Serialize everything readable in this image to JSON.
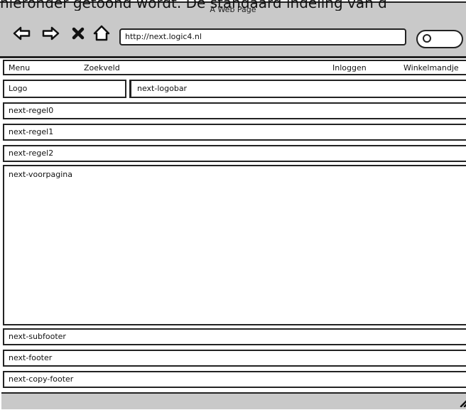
{
  "caption": "hieronder getoond wordt. De standaard indeling van d",
  "window": {
    "title": "A Web Page",
    "address": "http://next.logic4.nl"
  },
  "menu": {
    "menu_label": "Menu",
    "search_label": "Zoekveld",
    "login_label": "Inloggen",
    "cart_label": "Winkelmandje"
  },
  "logo": {
    "logo_label": "Logo",
    "logobar_label": "next-logobar"
  },
  "rows": {
    "regel0": "next-regel0",
    "regel1": "next-regel1",
    "regel2": "next-regel2",
    "voorpagina": "next-voorpagina",
    "subfooter": "next-subfooter",
    "footer": "next-footer",
    "copy_footer": "next-copy-footer"
  },
  "icons": {
    "back": "arrow-left-icon",
    "forward": "arrow-right-icon",
    "stop": "close-icon",
    "home": "home-icon",
    "search": "search-icon",
    "resize": "resize-grip-icon"
  }
}
